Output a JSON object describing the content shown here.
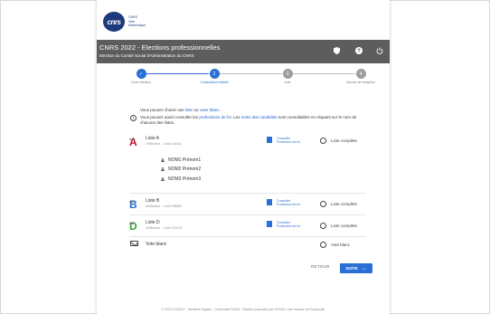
{
  "header": {
    "logo_text": "cnrs",
    "logo_caption_1": "CNRS",
    "logo_caption_2": "Vote",
    "logo_caption_3": "électronique"
  },
  "banner": {
    "title": "CNRS 2022 - Elections professionnelles",
    "subtitle": "Election du Comité Social d'Administration du CNRS",
    "icons": [
      "shield-icon",
      "help-icon",
      "power-icon"
    ]
  },
  "steps": [
    {
      "number": "✓",
      "label": "Choix élection",
      "state": "done"
    },
    {
      "number": "2",
      "label": "Consultation bulletin",
      "state": "active"
    },
    {
      "number": "3",
      "label": "Vote",
      "state": "todo"
    },
    {
      "number": "4",
      "label": "Accusé de réception",
      "state": "todo"
    }
  ],
  "intro": {
    "line1_prefix": "Vous pouvez choisir une",
    "line1_link1": "liste",
    "line1_mid": "ou",
    "line1_link2": "voter blanc",
    "line1_suffix": ".",
    "line2_prefix": "Vous pouvez aussi consulter les",
    "line2_link1": "professions de foi",
    "line2_mid": ". Les",
    "line2_link2": "noms des candidats",
    "line2_suffix": "sont consultables en cliquant sur le nom de",
    "line3": "chacune des listes."
  },
  "lists": [
    {
      "letter": "A",
      "color": "#c0102a",
      "name": "Liste A",
      "affiliation": "Affiliation : Liste AAAA",
      "consult_1": "Consulter",
      "consult_2": "Profession de foi",
      "radio_label": "Liste complète",
      "candidates": [
        "NOM1 Prénom1",
        "NOM2 Prénom2",
        "NOM3 Prénom3"
      ]
    },
    {
      "letter": "B",
      "color": "#2a6fd6",
      "name": "Liste B",
      "affiliation": "Affiliation : Liste BBBB",
      "consult_1": "Consulter",
      "consult_2": "Profession de foi",
      "radio_label": "Liste complète"
    },
    {
      "letter": "D",
      "color": "#3aa33a",
      "name": "Liste D",
      "affiliation": "Affiliation : Liste DDDD",
      "consult_1": "Consulter",
      "consult_2": "Profession de foi",
      "radio_label": "Liste complète"
    }
  ],
  "blank_vote": {
    "label": "Vote blanc",
    "radio_label": "Vote blanc"
  },
  "actions": {
    "back": "RETOUR",
    "next": "SUITE",
    "next_arrow": "→"
  },
  "footer": "© 2022 VOXALY - Mentions légales - Conformité RGAA - Solution proposée par VOXALY une marque de Europoulie",
  "colors": {
    "accent": "#2a6fd6",
    "banner": "#5d5d5d"
  }
}
